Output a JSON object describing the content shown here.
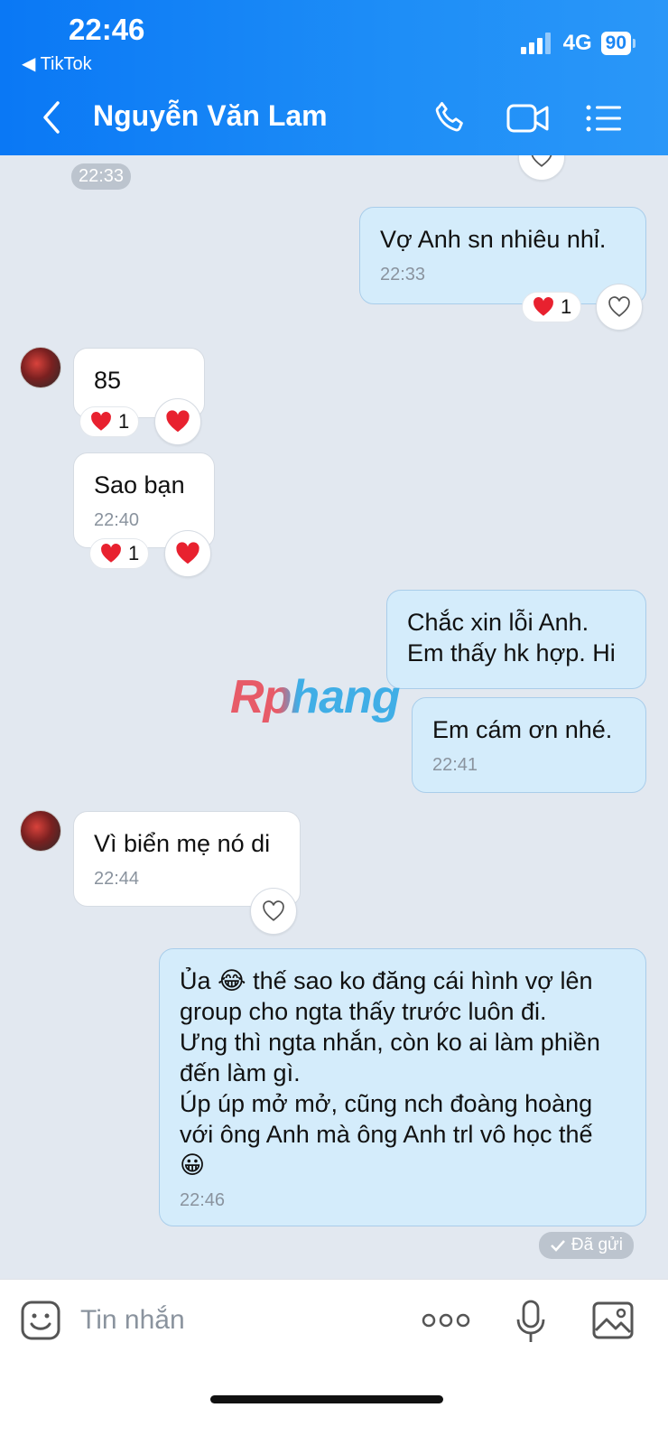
{
  "status_bar": {
    "time": "22:46",
    "back_app": "◀ TikTok",
    "network": "4G",
    "battery": "90"
  },
  "header": {
    "contact_name": "Nguyễn Văn Lam"
  },
  "icons": {
    "back": "chevron-left-icon",
    "call": "phone-icon",
    "video": "video-camera-icon",
    "menu": "list-menu-icon",
    "heart": "heart-icon",
    "sticker": "sticker-icon",
    "more": "more-dots-icon",
    "mic": "microphone-icon",
    "image": "image-icon"
  },
  "colors": {
    "header": "#1e8ef7",
    "outgoing_bubble": "#d4ecfb",
    "incoming_bubble": "#ffffff",
    "chat_bg": "#e2e8f0"
  },
  "watermark": "Rphang",
  "messages": {
    "top_time": "22:33",
    "m1": {
      "text": "Vợ Anh sn nhiêu nhỉ.",
      "time": "22:33",
      "reaction_count": "1"
    },
    "m2": {
      "text": "85",
      "reaction_count": "1"
    },
    "m3": {
      "text": "Sao bạn",
      "time": "22:40",
      "reaction_count": "1"
    },
    "m4": {
      "line1": "Chắc xin lỗi Anh.",
      "line2": "Em thấy hk hợp. Hi"
    },
    "m5": {
      "text": "Em cám ơn nhé.",
      "time": "22:41"
    },
    "m6": {
      "text": "Vì biển mẹ nó di",
      "time": "22:44"
    },
    "m7": {
      "line1": "Ủa 😂 thế sao ko đăng cái hình vợ lên",
      "line2": "group cho ngta thấy trước luôn đi.",
      "line3": "Ưng thì ngta nhắn, còn ko ai làm phiền",
      "line4": "đến làm gì.",
      "line5": "Úp úp mở mở, cũng nch đoàng hoàng",
      "line6": "với ông Anh mà ông Anh trl vô học thế",
      "line7": "😀",
      "time": "22:46"
    },
    "sent_status": "Đã gửi"
  },
  "input": {
    "placeholder": "Tin nhắn"
  }
}
